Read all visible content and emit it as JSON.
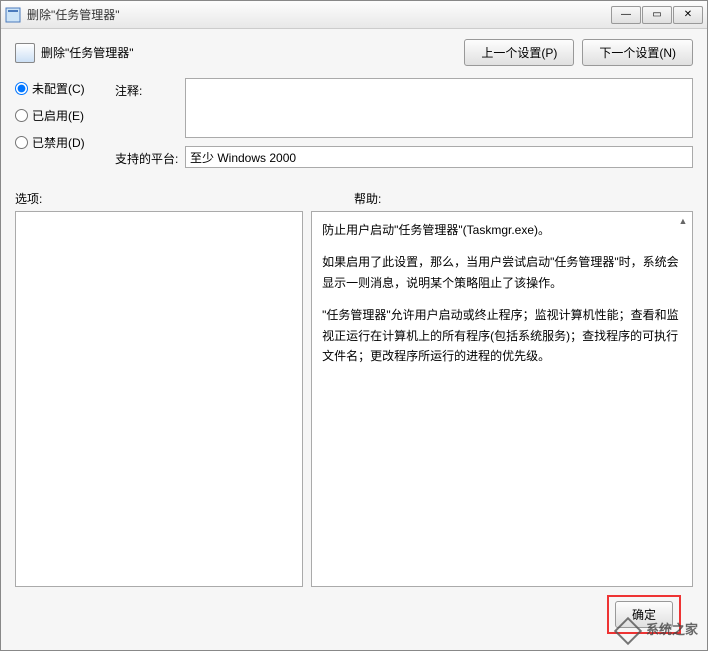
{
  "titlebar": {
    "title": "删除\"任务管理器\""
  },
  "header": {
    "title": "删除\"任务管理器\"",
    "prev_btn": "上一个设置(P)",
    "next_btn": "下一个设置(N)"
  },
  "radios": {
    "not_configured": "未配置(C)",
    "enabled": "已启用(E)",
    "disabled": "已禁用(D)"
  },
  "form": {
    "comment_label": "注释:",
    "comment_value": "",
    "platform_label": "支持的平台:",
    "platform_value": "至少 Windows 2000"
  },
  "panels": {
    "options_label": "选项:",
    "help_label": "帮助:"
  },
  "help": {
    "p1": "防止用户启动\"任务管理器\"(Taskmgr.exe)。",
    "p2": "如果启用了此设置，那么，当用户尝试启动\"任务管理器\"时，系统会显示一则消息，说明某个策略阻止了该操作。",
    "p3": "\"任务管理器\"允许用户启动或终止程序；监视计算机性能；查看和监视正运行在计算机上的所有程序(包括系统服务)；查找程序的可执行文件名；更改程序所运行的进程的优先级。"
  },
  "footer": {
    "ok": "确定"
  },
  "watermark": {
    "text": "系统之家"
  }
}
